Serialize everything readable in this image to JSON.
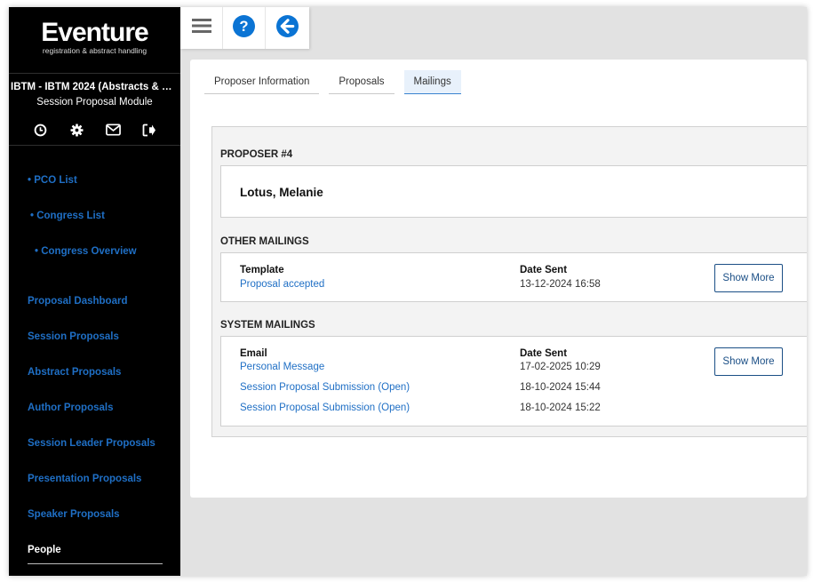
{
  "brand": {
    "title": "Eventure",
    "subtitle": "registration & abstract handling"
  },
  "project": {
    "name": "IBTM - IBTM 2024 (Abstracts & Par...",
    "module": "Session Proposal Module"
  },
  "sidebar_icons": [
    "clock-icon",
    "gear-icon",
    "envelope-icon",
    "sign-out-icon"
  ],
  "nav": {
    "pco_list": "• PCO List",
    "congress_list": "• Congress List",
    "congress_overview": "• Congress Overview",
    "proposal_dashboard": "Proposal Dashboard",
    "session_proposals": "Session Proposals",
    "abstract_proposals": "Abstract Proposals",
    "author_proposals": "Author Proposals",
    "session_leader_proposals": "Session Leader Proposals",
    "presentation_proposals": "Presentation Proposals",
    "speaker_proposals": "Speaker Proposals",
    "people": "People"
  },
  "toolbar": [
    "menu-icon",
    "help-icon",
    "back-arrow-icon"
  ],
  "tabs": [
    {
      "label": "Proposer Information",
      "active": false
    },
    {
      "label": "Proposals",
      "active": false
    },
    {
      "label": "Mailings",
      "active": true
    }
  ],
  "proposer": {
    "heading": "PROPOSER #4",
    "name": "Lotus, Melanie"
  },
  "other_mailings": {
    "heading": "OTHER MAILINGS",
    "col_template": "Template",
    "col_date": "Date Sent",
    "rows": [
      {
        "template": "Proposal accepted",
        "date": "13-12-2024 16:58"
      }
    ],
    "button": "Show More"
  },
  "system_mailings": {
    "heading": "SYSTEM MAILINGS",
    "col_email": "Email",
    "col_date": "Date Sent",
    "rows": [
      {
        "email": "Personal Message",
        "date": "17-02-2025 10:29"
      },
      {
        "email": "Session Proposal Submission (Open)",
        "date": "18-10-2024 15:44"
      },
      {
        "email": "Session Proposal Submission (Open)",
        "date": "18-10-2024 15:22"
      }
    ],
    "button": "Show More"
  },
  "colors": {
    "link": "#1f6fc5",
    "accent": "#0b74d4",
    "sidebar": "#000000",
    "button_border": "#1b4f86"
  }
}
